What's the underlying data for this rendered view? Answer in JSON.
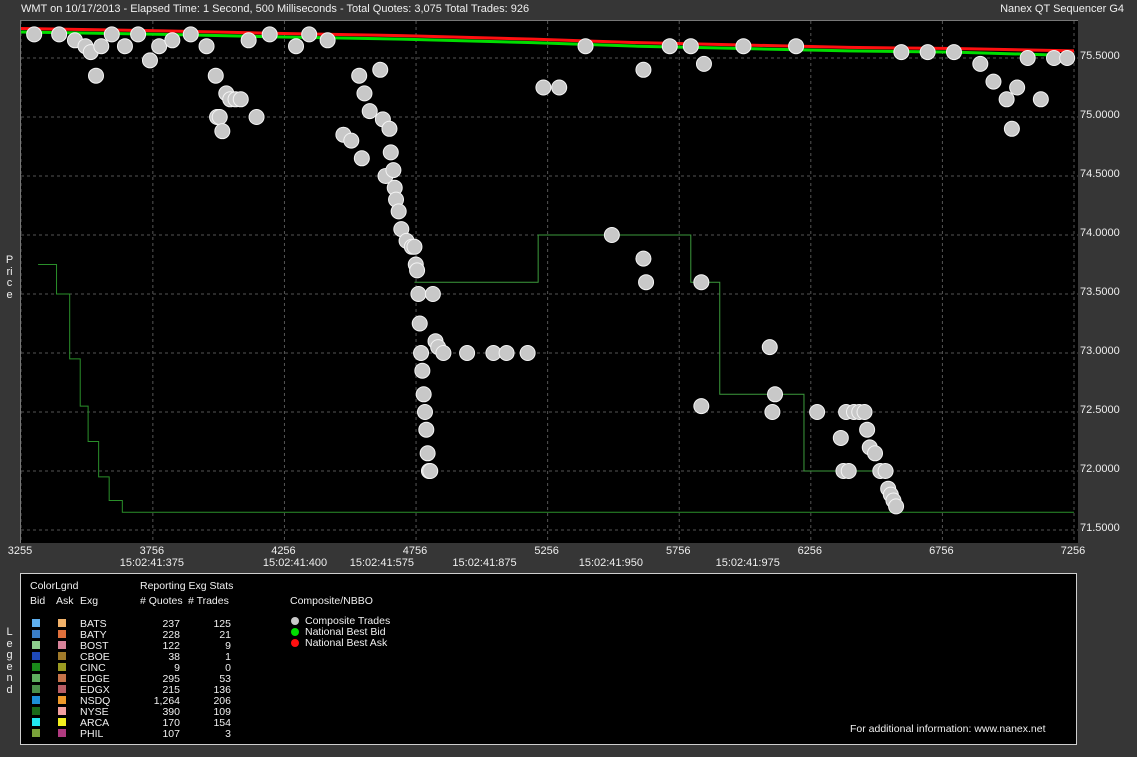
{
  "header": {
    "left": "WMT on 10/17/2013  -  Elapsed Time: 1 Second, 500 Milliseconds  -  Total Quotes: 3,075  Total Trades: 926",
    "right": "Nanex QT Sequencer G4"
  },
  "chart_data": {
    "type": "scatter",
    "ylabel": "Price",
    "ylim": [
      71.4,
      75.9
    ],
    "xlim": [
      3255,
      7256
    ],
    "y_ticks": [
      "71.5000",
      "72.0000",
      "72.5000",
      "73.0000",
      "73.5000",
      "74.0000",
      "74.5000",
      "75.0000",
      "75.5000"
    ],
    "x_ticks": [
      "3255",
      "3756",
      "4256",
      "4756",
      "5256",
      "5756",
      "6256",
      "6756",
      "7256"
    ],
    "x_time_labels": [
      {
        "seq": 3756,
        "label": "15:02:41:375"
      },
      {
        "seq": 4300,
        "label": "15:02:41:400"
      },
      {
        "seq": 4630,
        "label": "15:02:41:575"
      },
      {
        "seq": 5020,
        "label": "15:02:41:875"
      },
      {
        "seq": 5500,
        "label": "15:02:41:950"
      },
      {
        "seq": 6020,
        "label": "15:02:41:975"
      }
    ],
    "series": [
      {
        "name": "Composite Trades",
        "color": "#c8c8c8",
        "kind": "points",
        "points": [
          [
            3305,
            75.7
          ],
          [
            3400,
            75.7
          ],
          [
            3460,
            75.65
          ],
          [
            3500,
            75.6
          ],
          [
            3520,
            75.55
          ],
          [
            3540,
            75.35
          ],
          [
            3560,
            75.6
          ],
          [
            3600,
            75.7
          ],
          [
            3650,
            75.6
          ],
          [
            3700,
            75.7
          ],
          [
            3745,
            75.48
          ],
          [
            3780,
            75.6
          ],
          [
            3830,
            75.65
          ],
          [
            3900,
            75.7
          ],
          [
            3960,
            75.6
          ],
          [
            3995,
            75.35
          ],
          [
            4000,
            75.0
          ],
          [
            4010,
            75.0
          ],
          [
            4020,
            74.88
          ],
          [
            4035,
            75.2
          ],
          [
            4050,
            75.15
          ],
          [
            4070,
            75.15
          ],
          [
            4090,
            75.15
          ],
          [
            4120,
            75.65
          ],
          [
            4150,
            75.0
          ],
          [
            4200,
            75.7
          ],
          [
            4300,
            75.6
          ],
          [
            4350,
            75.7
          ],
          [
            4420,
            75.65
          ],
          [
            4480,
            74.85
          ],
          [
            4510,
            74.8
          ],
          [
            4540,
            75.35
          ],
          [
            4550,
            74.65
          ],
          [
            4560,
            75.2
          ],
          [
            4580,
            75.05
          ],
          [
            4620,
            75.4
          ],
          [
            4630,
            74.98
          ],
          [
            4640,
            74.5
          ],
          [
            4655,
            74.9
          ],
          [
            4660,
            74.7
          ],
          [
            4670,
            74.55
          ],
          [
            4675,
            74.4
          ],
          [
            4680,
            74.3
          ],
          [
            4690,
            74.2
          ],
          [
            4700,
            74.05
          ],
          [
            4720,
            73.95
          ],
          [
            4740,
            73.9
          ],
          [
            4750,
            73.9
          ],
          [
            4755,
            73.75
          ],
          [
            4760,
            73.7
          ],
          [
            4765,
            73.5
          ],
          [
            4770,
            73.25
          ],
          [
            4775,
            73.0
          ],
          [
            4780,
            72.85
          ],
          [
            4785,
            72.65
          ],
          [
            4790,
            72.5
          ],
          [
            4795,
            72.35
          ],
          [
            4800,
            72.15
          ],
          [
            4805,
            72.0
          ],
          [
            4810,
            72.0
          ],
          [
            4820,
            73.5
          ],
          [
            4830,
            73.1
          ],
          [
            4840,
            73.05
          ],
          [
            4860,
            73.0
          ],
          [
            4950,
            73.0
          ],
          [
            5050,
            73.0
          ],
          [
            5100,
            73.0
          ],
          [
            5180,
            73.0
          ],
          [
            5240,
            75.25
          ],
          [
            5300,
            75.25
          ],
          [
            5400,
            75.6
          ],
          [
            5500,
            74.0
          ],
          [
            5620,
            73.8
          ],
          [
            5630,
            73.6
          ],
          [
            5620,
            75.4
          ],
          [
            5720,
            75.6
          ],
          [
            5800,
            75.6
          ],
          [
            5840,
            72.55
          ],
          [
            5840,
            73.6
          ],
          [
            5850,
            75.45
          ],
          [
            6000,
            75.6
          ],
          [
            6100,
            73.05
          ],
          [
            6120,
            72.65
          ],
          [
            6110,
            72.5
          ],
          [
            6200,
            75.6
          ],
          [
            6280,
            72.5
          ],
          [
            6370,
            72.28
          ],
          [
            6380,
            72.0
          ],
          [
            6390,
            72.5
          ],
          [
            6400,
            72.0
          ],
          [
            6420,
            72.5
          ],
          [
            6440,
            72.5
          ],
          [
            6460,
            72.5
          ],
          [
            6470,
            72.35
          ],
          [
            6480,
            72.2
          ],
          [
            6500,
            72.15
          ],
          [
            6520,
            72.0
          ],
          [
            6540,
            72.0
          ],
          [
            6550,
            71.85
          ],
          [
            6560,
            71.8
          ],
          [
            6570,
            71.75
          ],
          [
            6580,
            71.7
          ],
          [
            6600,
            75.55
          ],
          [
            6700,
            75.55
          ],
          [
            6800,
            75.55
          ],
          [
            6900,
            75.45
          ],
          [
            6950,
            75.3
          ],
          [
            7000,
            75.15
          ],
          [
            7020,
            74.9
          ],
          [
            7040,
            75.25
          ],
          [
            7080,
            75.5
          ],
          [
            7130,
            75.15
          ],
          [
            7180,
            75.5
          ],
          [
            7230,
            75.5
          ]
        ]
      },
      {
        "name": "National Best Bid",
        "color": "#00dd00",
        "kind": "line",
        "points": [
          [
            3255,
            75.72
          ],
          [
            3800,
            75.7
          ],
          [
            4200,
            75.68
          ],
          [
            4700,
            75.66
          ],
          [
            5200,
            75.63
          ],
          [
            5600,
            75.6
          ],
          [
            6000,
            75.58
          ],
          [
            6400,
            75.56
          ],
          [
            6800,
            75.55
          ],
          [
            7256,
            75.52
          ]
        ]
      },
      {
        "name": "National Best Ask",
        "color": "#ff1010",
        "kind": "line",
        "points": [
          [
            3255,
            75.75
          ],
          [
            3800,
            75.73
          ],
          [
            4200,
            75.71
          ],
          [
            4700,
            75.69
          ],
          [
            5200,
            75.66
          ],
          [
            5600,
            75.63
          ],
          [
            6000,
            75.61
          ],
          [
            6400,
            75.59
          ],
          [
            6800,
            75.58
          ],
          [
            7256,
            75.56
          ]
        ]
      },
      {
        "name": "NSDQ",
        "color": "#2a8f2a",
        "kind": "step",
        "points": [
          [
            3320,
            73.75
          ],
          [
            3370,
            73.75
          ],
          [
            3390,
            73.5
          ],
          [
            3440,
            72.95
          ],
          [
            3480,
            72.55
          ],
          [
            3510,
            72.25
          ],
          [
            3550,
            71.95
          ],
          [
            3590,
            71.75
          ],
          [
            3640,
            71.65
          ],
          [
            4000,
            71.65
          ],
          [
            5000,
            71.65
          ],
          [
            6000,
            71.65
          ],
          [
            7256,
            71.65
          ]
        ]
      },
      {
        "name": "EDGE",
        "color": "#3c9a3c",
        "kind": "step",
        "points": [
          [
            4750,
            73.6
          ],
          [
            5200,
            73.6
          ],
          [
            5220,
            74.0
          ],
          [
            5790,
            74.0
          ],
          [
            5800,
            73.6
          ],
          [
            5900,
            73.6
          ],
          [
            5910,
            72.65
          ],
          [
            6220,
            72.65
          ],
          [
            6230,
            72.0
          ],
          [
            6500,
            72.0
          ]
        ]
      }
    ]
  },
  "legend": {
    "title": "Legend",
    "col_color": "ColorLgnd",
    "col_bid": "Bid",
    "col_ask": "Ask",
    "col_exg": "Exg",
    "col_stats": "Reporting Exg Stats",
    "col_quotes": "# Quotes",
    "col_trades": "# Trades",
    "rows": [
      {
        "exg": "BATS",
        "quotes": "237",
        "trades": "125",
        "bid": "#5fb0ef",
        "ask": "#f2b26a"
      },
      {
        "exg": "BATY",
        "quotes": "228",
        "trades": "21",
        "bid": "#3a7ec9",
        "ask": "#e0703c"
      },
      {
        "exg": "BOST",
        "quotes": "122",
        "trades": "9",
        "bid": "#8ccf8c",
        "ask": "#d8839a"
      },
      {
        "exg": "CBOE",
        "quotes": "38",
        "trades": "1",
        "bid": "#1e49b8",
        "ask": "#a07a2a"
      },
      {
        "exg": "CINC",
        "quotes": "9",
        "trades": "0",
        "bid": "#1a8a1a",
        "ask": "#9b9b22"
      },
      {
        "exg": "EDGE",
        "quotes": "295",
        "trades": "53",
        "bid": "#5fae5f",
        "ask": "#c7744a"
      },
      {
        "exg": "EDGX",
        "quotes": "215",
        "trades": "136",
        "bid": "#4a8f4a",
        "ask": "#b85e66"
      },
      {
        "exg": "NSDQ",
        "quotes": "1,264",
        "trades": "206",
        "bid": "#1c8fd8",
        "ask": "#ee9a2a"
      },
      {
        "exg": "NYSE",
        "quotes": "390",
        "trades": "109",
        "bid": "#1a6a1a",
        "ask": "#f2a0a0"
      },
      {
        "exg": "ARCA",
        "quotes": "170",
        "trades": "154",
        "bid": "#22e8f0",
        "ask": "#f2ee1e"
      },
      {
        "exg": "PHIL",
        "quotes": "107",
        "trades": "3",
        "bid": "#7aa23a",
        "ask": "#b03a80"
      }
    ],
    "composite_title": "Composite/NBBO",
    "composite": [
      {
        "label": "Composite Trades",
        "color": "#c8c8c8"
      },
      {
        "label": "National Best Bid",
        "color": "#00dd00"
      },
      {
        "label": "National Best Ask",
        "color": "#ff1010"
      }
    ],
    "footer": "For additional information: www.nanex.net"
  }
}
